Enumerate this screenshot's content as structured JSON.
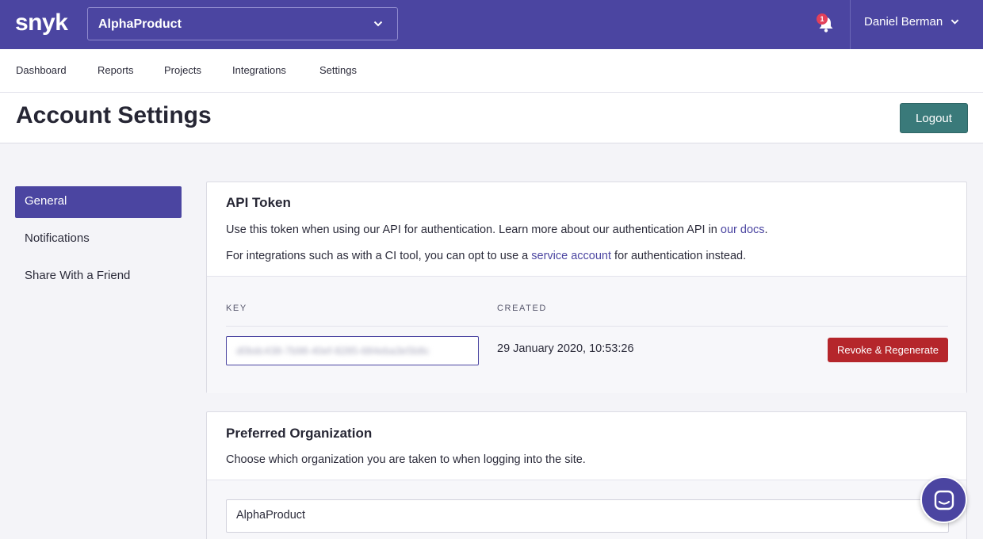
{
  "topbar": {
    "logo": "snyk",
    "org_selector": "AlphaProduct",
    "notification_count": "1",
    "user_name": "Daniel Berman"
  },
  "nav": [
    "Dashboard",
    "Reports",
    "Projects",
    "Integrations",
    "Settings"
  ],
  "header": {
    "title": "Account Settings",
    "logout_label": "Logout"
  },
  "sidebar": {
    "items": [
      {
        "label": "General",
        "active": true
      },
      {
        "label": "Notifications",
        "active": false
      },
      {
        "label": "Share With a Friend",
        "active": false
      }
    ]
  },
  "api_token": {
    "title": "API Token",
    "desc1_prefix": "Use this token when using our API for authentication. Learn more about our authentication API in ",
    "desc1_link": "our docs",
    "desc1_suffix": ".",
    "desc2_prefix": "For integrations such as with a CI tool, you can opt to use a ",
    "desc2_link": "service account",
    "desc2_suffix": " for authentication instead.",
    "col_key": "KEY",
    "col_created": "CREATED",
    "key_value": "d0bdc438-7b98-40ef-8285-684eba3e5b8c",
    "created_value": "29 January 2020, 10:53:26",
    "revoke_label": "Revoke & Regenerate"
  },
  "preferred_org": {
    "title": "Preferred Organization",
    "desc": "Choose which organization you are taken to when logging into the site.",
    "value": "AlphaProduct"
  },
  "colors": {
    "brand": "#4b45a1",
    "logout": "#3a7a7a",
    "danger": "#b5262b"
  },
  "icons": [
    "chevron-down-icon",
    "bell-icon",
    "chat-icon"
  ]
}
